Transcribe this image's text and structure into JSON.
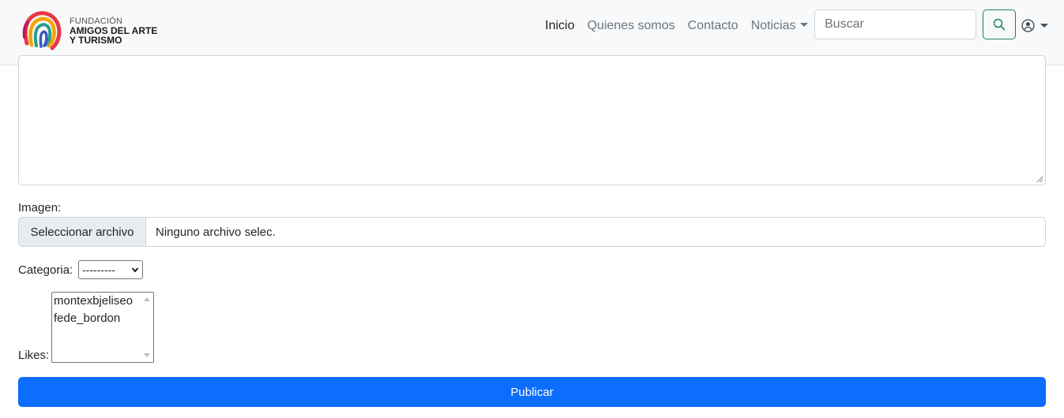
{
  "brand": {
    "line1": "FUNDACIÓN",
    "line2": "AMIGOS DEL ARTE",
    "line3": "Y TURISMO"
  },
  "nav": {
    "items": [
      {
        "label": "Inicio",
        "active": true
      },
      {
        "label": "Quienes somos",
        "active": false
      },
      {
        "label": "Contacto",
        "active": false
      },
      {
        "label": "Noticias",
        "active": false,
        "dropdown": true
      }
    ],
    "search_placeholder": "Buscar",
    "search_icon": "search-icon",
    "user_icon": "user-circle-icon"
  },
  "form": {
    "image_label": "Imagen:",
    "file_button_label": "Seleccionar archivo",
    "file_name": "Ninguno archivo selec.",
    "category_label": "Categoria:",
    "category_selected": "---------",
    "likes_label": "Likes:",
    "likes_options": [
      "montexbjeliseo",
      "fede_bordon"
    ],
    "submit_label": "Publicar"
  },
  "colors": {
    "primary": "#0d6efd",
    "success": "#198754",
    "navbar_bg": "#f8f9fa"
  }
}
